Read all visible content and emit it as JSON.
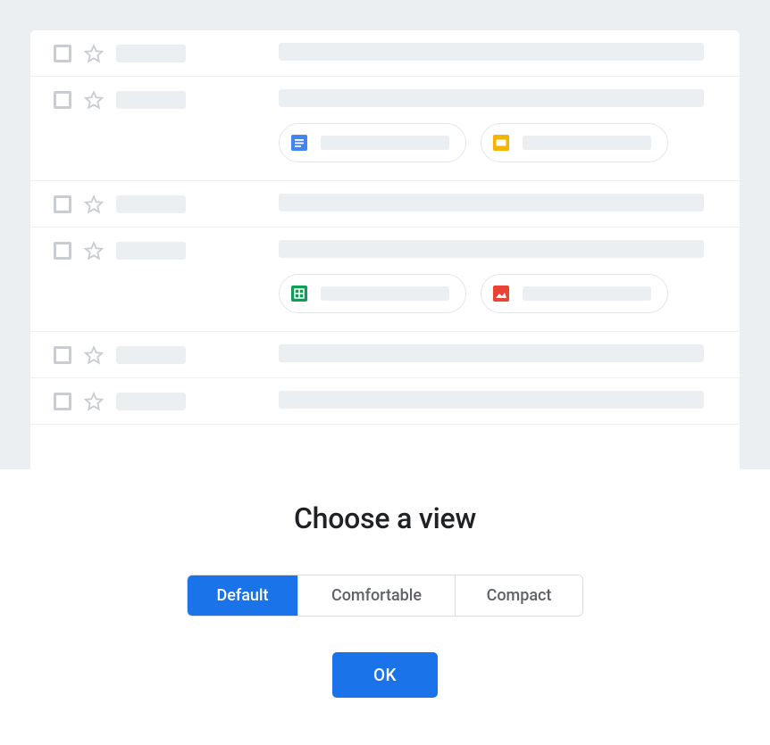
{
  "dialog": {
    "title": "Choose a view",
    "options": {
      "default": "Default",
      "comfortable": "Comfortable",
      "compact": "Compact"
    },
    "ok_label": "OK",
    "selected": "default"
  },
  "preview": {
    "rows": [
      {
        "has_chips": false
      },
      {
        "has_chips": true,
        "chips": [
          "docs",
          "slides"
        ]
      },
      {
        "has_chips": false
      },
      {
        "has_chips": true,
        "chips": [
          "sheets",
          "image"
        ]
      },
      {
        "has_chips": false
      },
      {
        "has_chips": false
      }
    ]
  },
  "colors": {
    "primary": "#1a73e8",
    "docs": "#4285f4",
    "slides": "#f4b400",
    "sheets": "#0f9d58",
    "image": "#ea4335"
  }
}
